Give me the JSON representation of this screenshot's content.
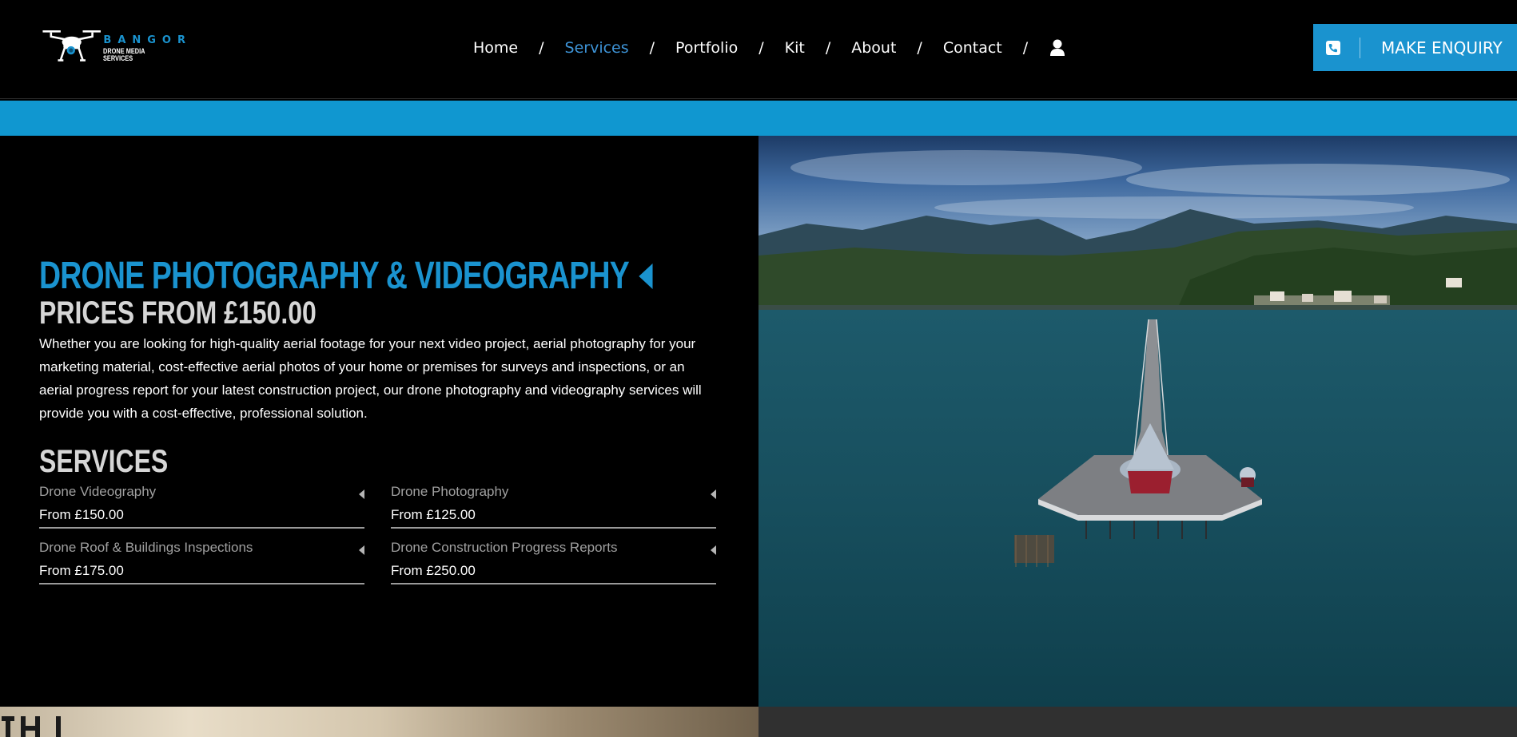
{
  "brand": {
    "name": "BANGOR",
    "tagline": "DRONE MEDIA SERVICES"
  },
  "nav": {
    "items": [
      {
        "label": "Home",
        "active": false
      },
      {
        "label": "Services",
        "active": true
      },
      {
        "label": "Portfolio",
        "active": false
      },
      {
        "label": "Kit",
        "active": false
      },
      {
        "label": "About",
        "active": false
      },
      {
        "label": "Contact",
        "active": false
      }
    ],
    "separator": "/",
    "account_icon": "user-icon"
  },
  "cta": {
    "label": "MAKE ENQUIRY",
    "icon": "phone-icon"
  },
  "hero": {
    "title": "DRONE PHOTOGRAPHY & VIDEOGRAPHY",
    "subtitle": "PRICES FROM £150.00",
    "description": "Whether you are looking for high-quality aerial footage for your next video project, aerial photography for your marketing material, cost-effective aerial photos of your home or premises for surveys and inspections, or an aerial progress report for your latest construction project, our drone photography and videography services will provide you with a cost-effective, professional solution."
  },
  "services": {
    "heading": "SERVICES",
    "items": [
      {
        "name": "Drone Videography",
        "price": "From £150.00"
      },
      {
        "name": "Drone Photography",
        "price": "From £125.00"
      },
      {
        "name": "Drone Roof & Buildings Inspections",
        "price": "From £175.00"
      },
      {
        "name": "Drone Construction Progress Reports",
        "price": "From £250.00"
      }
    ]
  },
  "colors": {
    "accent": "#1a93cf",
    "band": "#1097d0",
    "background": "#000000"
  }
}
